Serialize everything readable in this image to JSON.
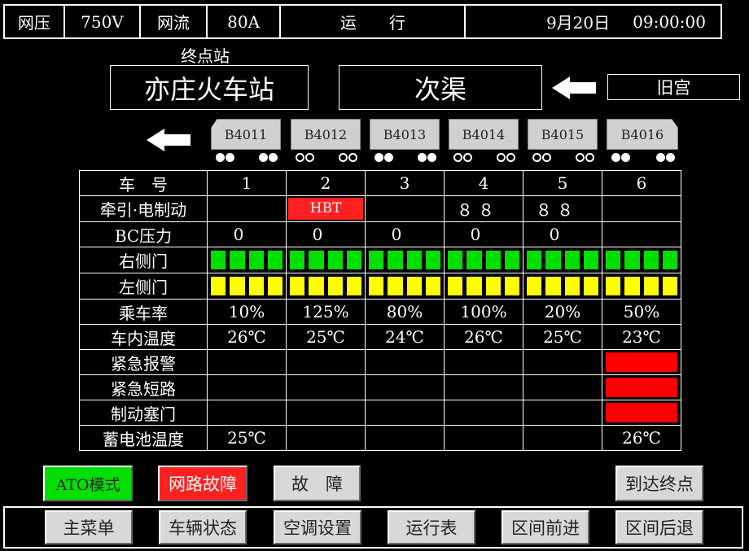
{
  "status": {
    "voltage_label": "网压",
    "voltage_value": "750V",
    "current_label": "网流",
    "current_value": "80A",
    "mode": "运　　行",
    "date": "9月20日",
    "time": "09:00:00"
  },
  "route": {
    "terminal_label": "终点站",
    "terminal": "亦庄火车站",
    "current_station": "次渠",
    "previous_station": "旧宫"
  },
  "cars": [
    "B4011",
    "B4012",
    "B4013",
    "B4014",
    "B4015",
    "B4016"
  ],
  "table": {
    "car_no_label": "车　号",
    "car_numbers": [
      "1",
      "2",
      "3",
      "4",
      "5",
      "6"
    ],
    "traction_label": "牵引·电制动",
    "traction": [
      "",
      "HBT",
      "",
      "８ ８",
      "８ ８",
      ""
    ],
    "bc_label": "BC压力",
    "bc": [
      "0",
      "0",
      "0",
      "0",
      "0",
      ""
    ],
    "right_door_label": "右侧门",
    "left_door_label": "左侧门",
    "load_label": "乘车率",
    "load": [
      "10%",
      "125%",
      "80%",
      "100%",
      "20%",
      "50%"
    ],
    "temp_label": "车内温度",
    "temp": [
      "26℃",
      "25℃",
      "24℃",
      "26℃",
      "25℃",
      "23℃"
    ],
    "emergency_alarm_label": "紧急报警",
    "emergency_short_label": "紧急短路",
    "brake_cutout_label": "制动塞门",
    "battery_temp_label": "蓄电池温度",
    "battery_temp": [
      "25℃",
      "",
      "",
      "",
      "",
      "26℃"
    ]
  },
  "colors": {
    "door_right": "#00e000",
    "door_left": "#ffff00",
    "alarm": "#ff0000",
    "fault": "#ff2020",
    "ato": "#00e000"
  },
  "indicators": {
    "ato": "ATO模式",
    "network_fault": "网路故障",
    "fault": "故　障",
    "arrive_terminal": "到达终点"
  },
  "menu": [
    "主菜单",
    "车辆状态",
    "空调设置",
    "运行表",
    "区间前进",
    "区间后退"
  ]
}
